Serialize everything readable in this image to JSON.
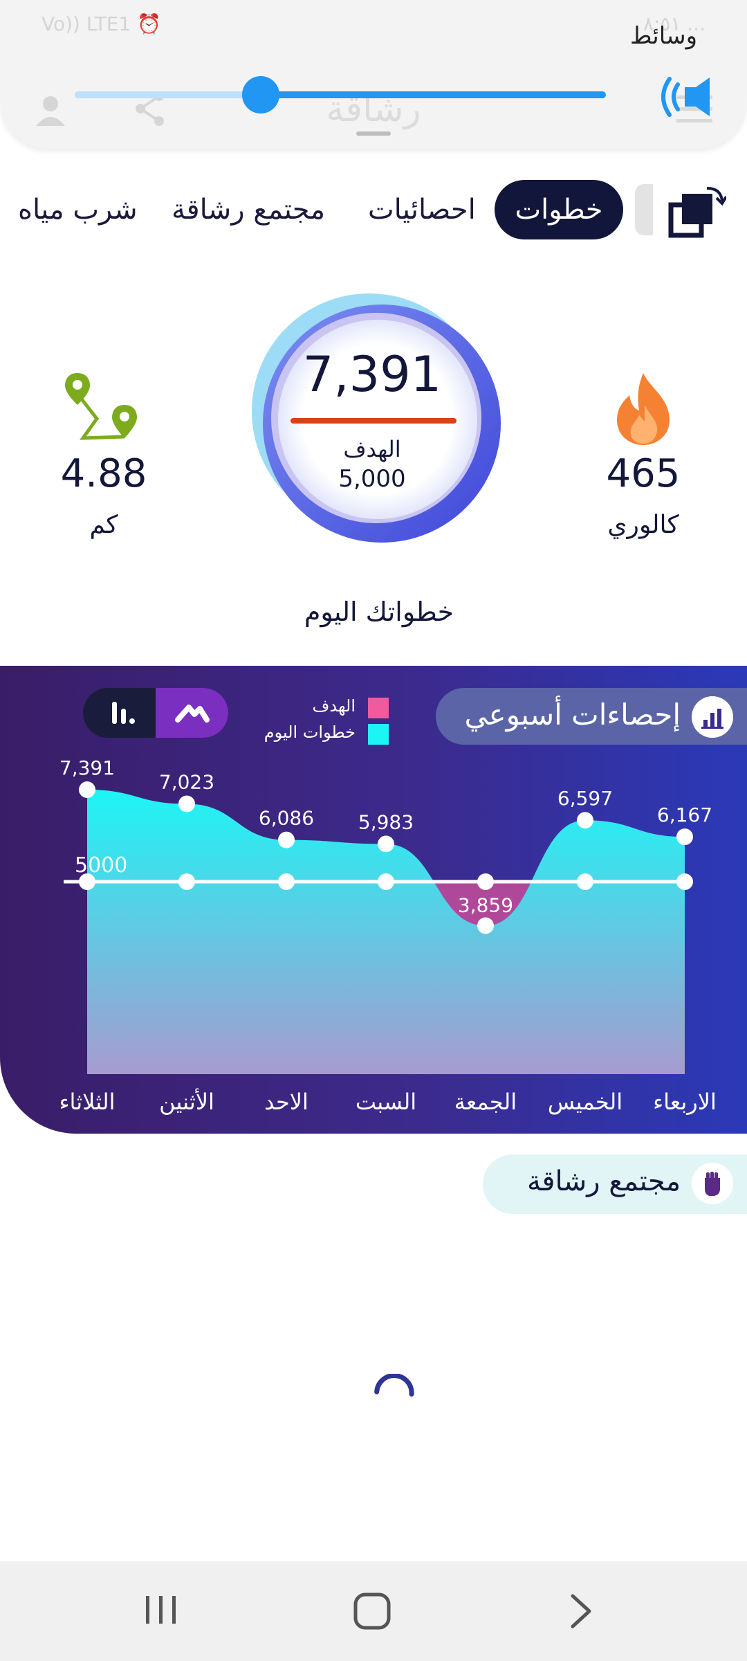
{
  "media_panel": {
    "label": "وسائط",
    "app_title_faint": "رشاقة",
    "status_left": "Vo)) LTE1 ⏰",
    "status_right": "٨:٥١ ...",
    "volume_fraction": 0.65
  },
  "tabs": {
    "steps": "خطوات",
    "stats": "احصائيات",
    "community": "مجتمع رشاقة",
    "water": "شرب مياه"
  },
  "today": {
    "steps_value": "7,391",
    "goal_label": "الهدف",
    "goal_value": "5,000",
    "caption": "خطواتك اليوم",
    "calories_value": "465",
    "calories_label": "كالوري",
    "distance_value": "4.88",
    "distance_label": "كم"
  },
  "weekly": {
    "title": "إحصاءات أسبوعي",
    "legend_goal": "الهدف",
    "legend_steps": "خطوات اليوم",
    "goal_line_label": "5000"
  },
  "chart_data": {
    "type": "area",
    "categories": [
      "الثلاثاء",
      "الأثنين",
      "الاحد",
      "السبت",
      "الجمعة",
      "الخميس",
      "الاربعاء"
    ],
    "series": [
      {
        "name": "خطوات اليوم",
        "values": [
          7391,
          7023,
          6086,
          5983,
          3859,
          6597,
          6167
        ]
      },
      {
        "name": "الهدف",
        "values": [
          5000,
          5000,
          5000,
          5000,
          5000,
          5000,
          5000
        ]
      }
    ],
    "data_labels": [
      "7,391",
      "7,023",
      "6,086",
      "5,983",
      "3,859",
      "6,597",
      "6,167"
    ],
    "ylim": [
      0,
      9000
    ],
    "colors": {
      "steps": "#1df5f5",
      "below_goal": "#b0489a",
      "goal_line": "#ffffff"
    }
  },
  "community": {
    "title": "مجتمع رشاقة"
  }
}
